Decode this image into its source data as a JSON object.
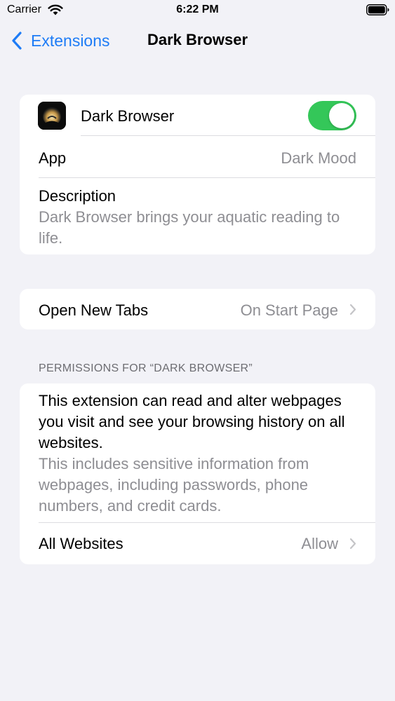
{
  "status_bar": {
    "carrier": "Carrier",
    "time": "6:22 PM"
  },
  "nav": {
    "back_label": "Extensions",
    "title": "Dark Browser"
  },
  "extension_card": {
    "name": "Dark Browser",
    "enabled": true,
    "app_label": "App",
    "app_value": "Dark Mood",
    "description_label": "Description",
    "description_text": "Dark Browser brings your aquatic reading to life."
  },
  "tabs_card": {
    "label": "Open New Tabs",
    "value": "On Start Page"
  },
  "permissions": {
    "header": "PERMISSIONS FOR “DARK BROWSER”",
    "main_text": "This extension can read and alter webpages you visit and see your browsing history on all websites.",
    "sub_text": "This includes sensitive information from webpages, including passwords, phone numbers, and credit cards.",
    "websites_label": "All Websites",
    "websites_value": "Allow"
  },
  "colors": {
    "accent": "#1e7cf6",
    "toggle_on": "#34c759",
    "background": "#f2f2f7",
    "secondary_text": "#8e8e93"
  }
}
